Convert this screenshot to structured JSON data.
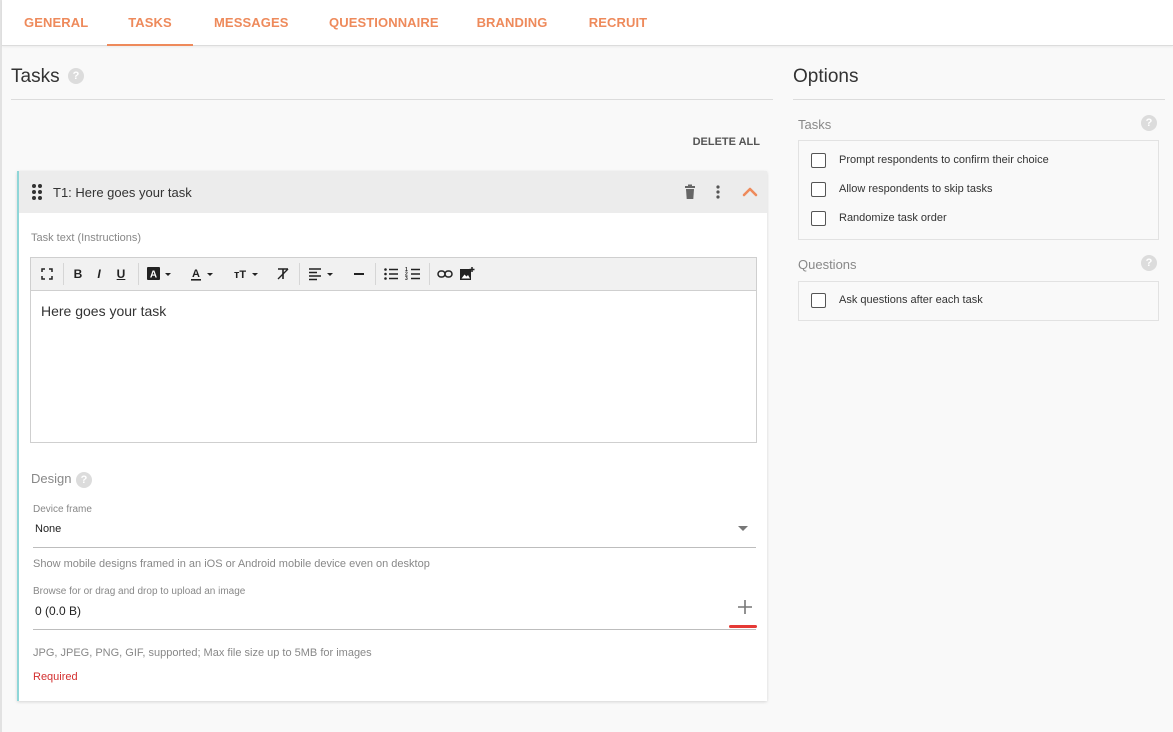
{
  "tabs": [
    {
      "label": "GENERAL"
    },
    {
      "label": "TASKS"
    },
    {
      "label": "MESSAGES"
    },
    {
      "label": "QUESTIONNAIRE"
    },
    {
      "label": "BRANDING"
    },
    {
      "label": "RECRUIT"
    }
  ],
  "active_tab": "TASKS",
  "tasks_section": {
    "title": "Tasks",
    "help": "?",
    "delete_all": "DELETE ALL"
  },
  "task": {
    "title": "T1: Here goes your task",
    "task_text_label": "Task text (Instructions)",
    "content": "Here goes your task",
    "design": {
      "title": "Design",
      "help": "?",
      "device_frame_label": "Device frame",
      "device_frame_value": "None",
      "device_frame_hint": "Show mobile designs framed in an iOS or Android mobile device even on desktop",
      "upload_label": "Browse for or drag and drop to upload an image",
      "upload_value": "0 (0.0 B)",
      "upload_hint": "JPG, JPEG, PNG, GIF, supported; Max file size up to 5MB for images",
      "required": "Required"
    }
  },
  "options": {
    "title": "Options",
    "tasks_group": {
      "title": "Tasks",
      "help": "?",
      "items": [
        {
          "label": "Prompt respondents to confirm their choice",
          "checked": false
        },
        {
          "label": "Allow respondents to skip tasks",
          "checked": false
        },
        {
          "label": "Randomize task order",
          "checked": false
        }
      ]
    },
    "questions_group": {
      "title": "Questions",
      "help": "?",
      "items": [
        {
          "label": "Ask questions after each task",
          "checked": false
        }
      ]
    }
  },
  "colors": {
    "accent": "#ee8a5b",
    "card_border": "#8fd6d8",
    "required": "#d32f2f"
  }
}
